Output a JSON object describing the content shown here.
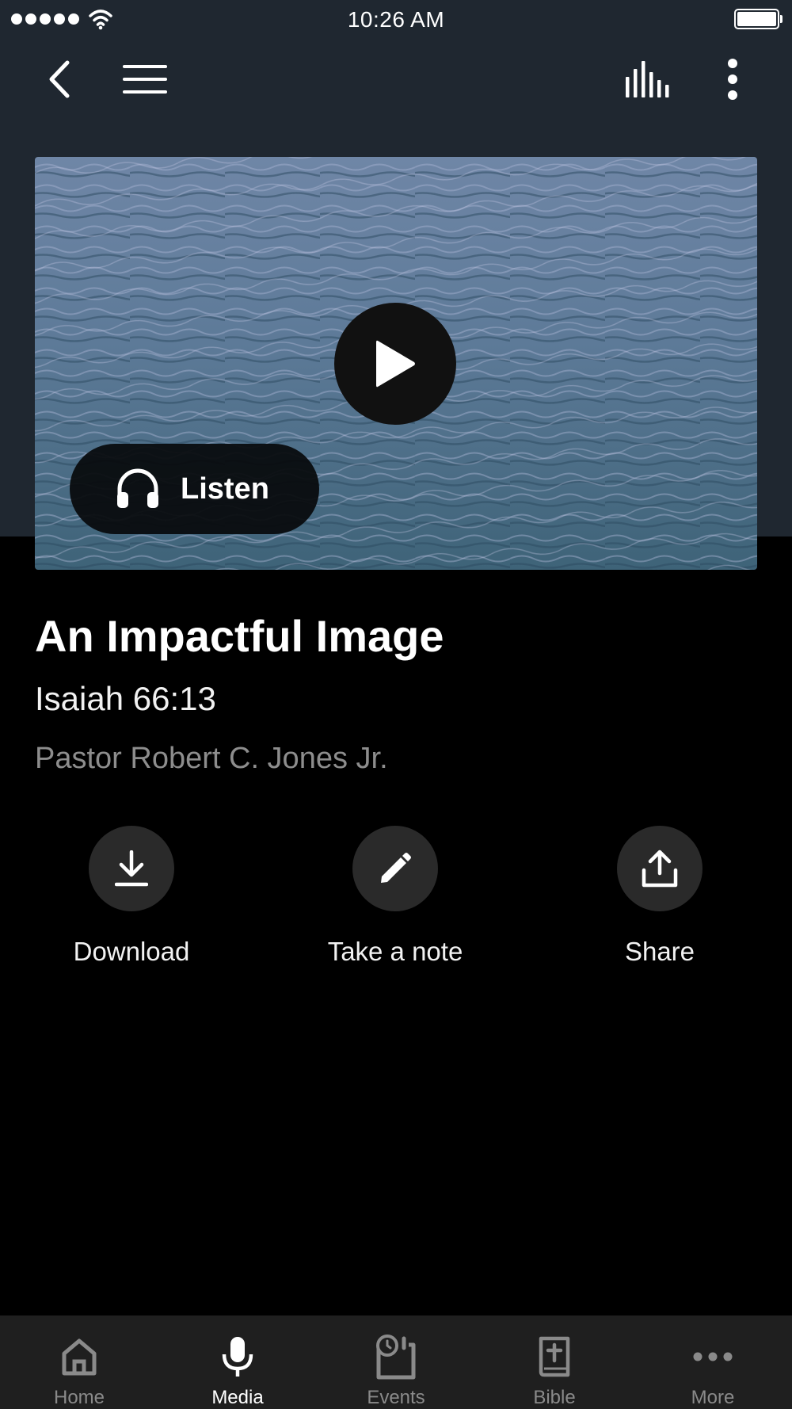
{
  "status_bar": {
    "time": "10:26 AM",
    "signal_icon": "signal-dots-icon",
    "wifi_icon": "wifi-icon",
    "battery_icon": "battery-icon"
  },
  "nav": {
    "back_icon": "chevron-left-icon",
    "menu_icon": "hamburger-menu-icon",
    "equalizer_icon": "audio-bars-icon",
    "more_icon": "vertical-dots-icon"
  },
  "hero": {
    "image": "ocean-water-image",
    "play_icon": "play-icon",
    "listen_label": "Listen",
    "listen_icon": "headphones-icon"
  },
  "sermon": {
    "title": "An Impactful Image",
    "scripture": "Isaiah 66:13",
    "speaker": "Pastor Robert C. Jones Jr."
  },
  "actions": [
    {
      "label": "Download",
      "icon": "download-icon"
    },
    {
      "label": "Take a note",
      "icon": "pencil-icon"
    },
    {
      "label": "Share",
      "icon": "share-upload-icon"
    }
  ],
  "tabs": [
    {
      "label": "Home",
      "icon": "home-icon",
      "active": false
    },
    {
      "label": "Media",
      "icon": "microphone-icon",
      "active": true
    },
    {
      "label": "Events",
      "icon": "calendar-clock-icon",
      "active": false
    },
    {
      "label": "Bible",
      "icon": "bible-icon",
      "active": false
    },
    {
      "label": "More",
      "icon": "horizontal-dots-icon",
      "active": false
    }
  ],
  "colors": {
    "header_bg": "#1f2730",
    "page_bg": "#000000",
    "tab_bar_bg": "#1f1f1f",
    "action_circle": "#2a2a2a",
    "muted_text": "#8d8d8d",
    "water": "#5a7990"
  }
}
